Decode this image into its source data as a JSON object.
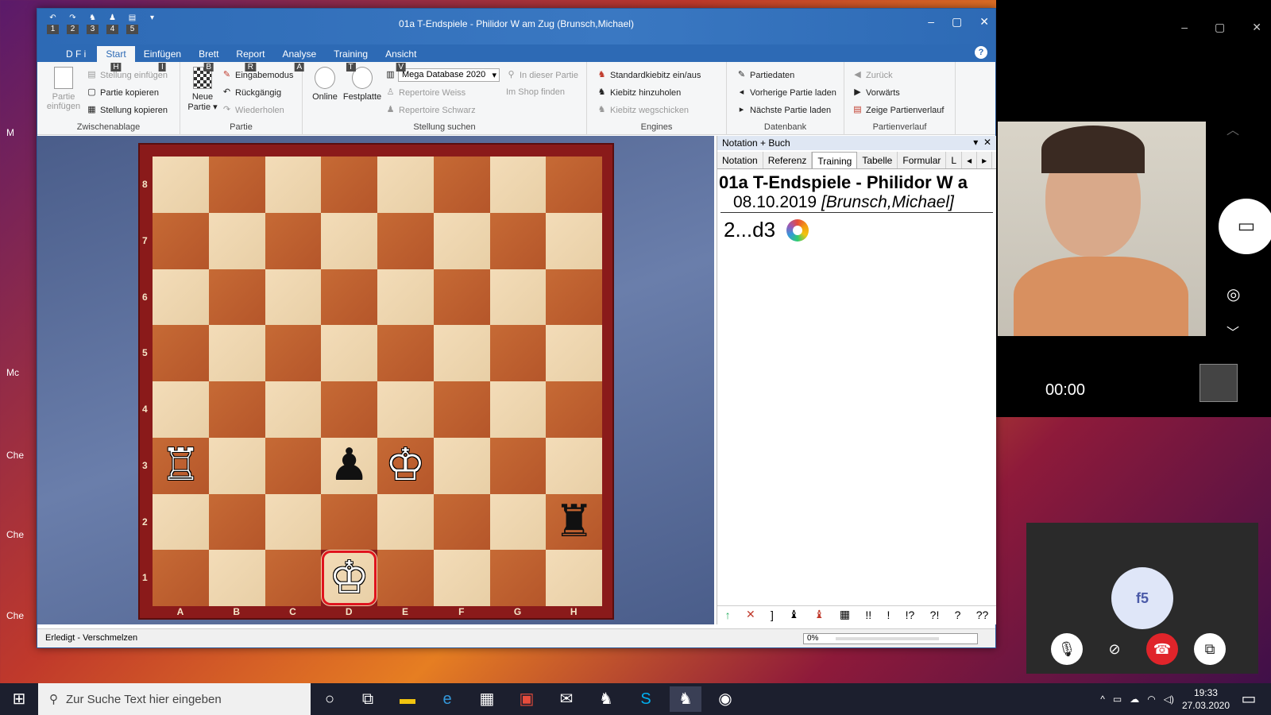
{
  "desktop": {
    "labels": [
      "M",
      "Mc",
      "Che",
      "Che",
      "Che"
    ]
  },
  "cb": {
    "title": "01a T-Endspiele - Philidor W am Zug  (Brunsch,Michael)",
    "qat_keys": [
      "1",
      "2",
      "3",
      "4",
      "5"
    ],
    "menu": [
      {
        "label": "Start",
        "key": "H"
      },
      {
        "label": "Einfügen",
        "key": "I"
      },
      {
        "label": "Brett",
        "key": "B"
      },
      {
        "label": "Report",
        "key": "R"
      },
      {
        "label": "Analyse",
        "key": "A"
      },
      {
        "label": "Training",
        "key": "T"
      },
      {
        "label": "Ansicht",
        "key": "V"
      }
    ],
    "file_menu": "D F i",
    "ribbon": {
      "clipboard": {
        "big_label": "Partie einfügen",
        "items": [
          "Stellung einfügen",
          "Partie kopieren",
          "Stellung kopieren"
        ],
        "group": "Zwischenablage"
      },
      "game": {
        "big_label": "Neue Partie",
        "items": [
          "Eingabemodus",
          "Rückgängig",
          "Wiederholen"
        ],
        "group": "Partie"
      },
      "search": {
        "online": "Online",
        "disk": "Festplatte",
        "db": "Mega Database 2020",
        "items": [
          "Repertoire Weiss",
          "Repertoire Schwarz"
        ],
        "in_game": "In dieser Partie",
        "shop": "Im Shop finden",
        "group": "Stellung suchen"
      },
      "engines": {
        "items": [
          "Standardkiebitz ein/aus",
          "Kiebitz hinzuholen",
          "Kiebitz wegschicken"
        ],
        "group": "Engines"
      },
      "db": {
        "items": [
          "Partiedaten",
          "Vorherige Partie laden",
          "Nächste Partie laden"
        ],
        "group": "Datenbank"
      },
      "history": {
        "items": [
          "Zurück",
          "Vorwärts",
          "Zeige Partienverlauf"
        ],
        "group": "Partienverlauf"
      }
    },
    "board": {
      "ranks": [
        "8",
        "7",
        "6",
        "5",
        "4",
        "3",
        "2",
        "1"
      ],
      "files": [
        "A",
        "B",
        "C",
        "D",
        "E",
        "F",
        "G",
        "H"
      ],
      "pieces": [
        {
          "square": "a3",
          "glyph": "♖",
          "color": "white",
          "name": "white-rook"
        },
        {
          "square": "d3",
          "glyph": "♟",
          "color": "black",
          "name": "black-pawn"
        },
        {
          "square": "e3",
          "glyph": "♔",
          "color": "white",
          "name": "black-king-on-e3"
        },
        {
          "square": "h2",
          "glyph": "♜",
          "color": "black",
          "name": "black-rook"
        },
        {
          "square": "d1",
          "glyph": "♔",
          "color": "white",
          "name": "white-king"
        }
      ],
      "highlight": "d1"
    },
    "notation": {
      "header": "Notation + Buch",
      "tabs": [
        "Notation",
        "Referenz",
        "Training",
        "Tabelle",
        "Formular",
        "L"
      ],
      "active_tab": "Training",
      "game_title": "01a T-Endspiele - Philidor W a",
      "game_date": "08.10.2019",
      "game_player": "[Brunsch,Michael]",
      "move": "2...d3",
      "symbols": [
        "↑",
        "✕",
        "]",
        "♝",
        "♝",
        "▦",
        "!!",
        "!",
        "!?",
        "?!",
        "?",
        "??"
      ]
    },
    "status": "Erledigt - Verschmelzen",
    "progress": "0%"
  },
  "skype": {
    "timer": "00:00",
    "avatar": "f5"
  },
  "taskbar": {
    "search_placeholder": "Zur Suche Text hier eingeben",
    "time": "19:33",
    "date": "27.03.2020"
  }
}
